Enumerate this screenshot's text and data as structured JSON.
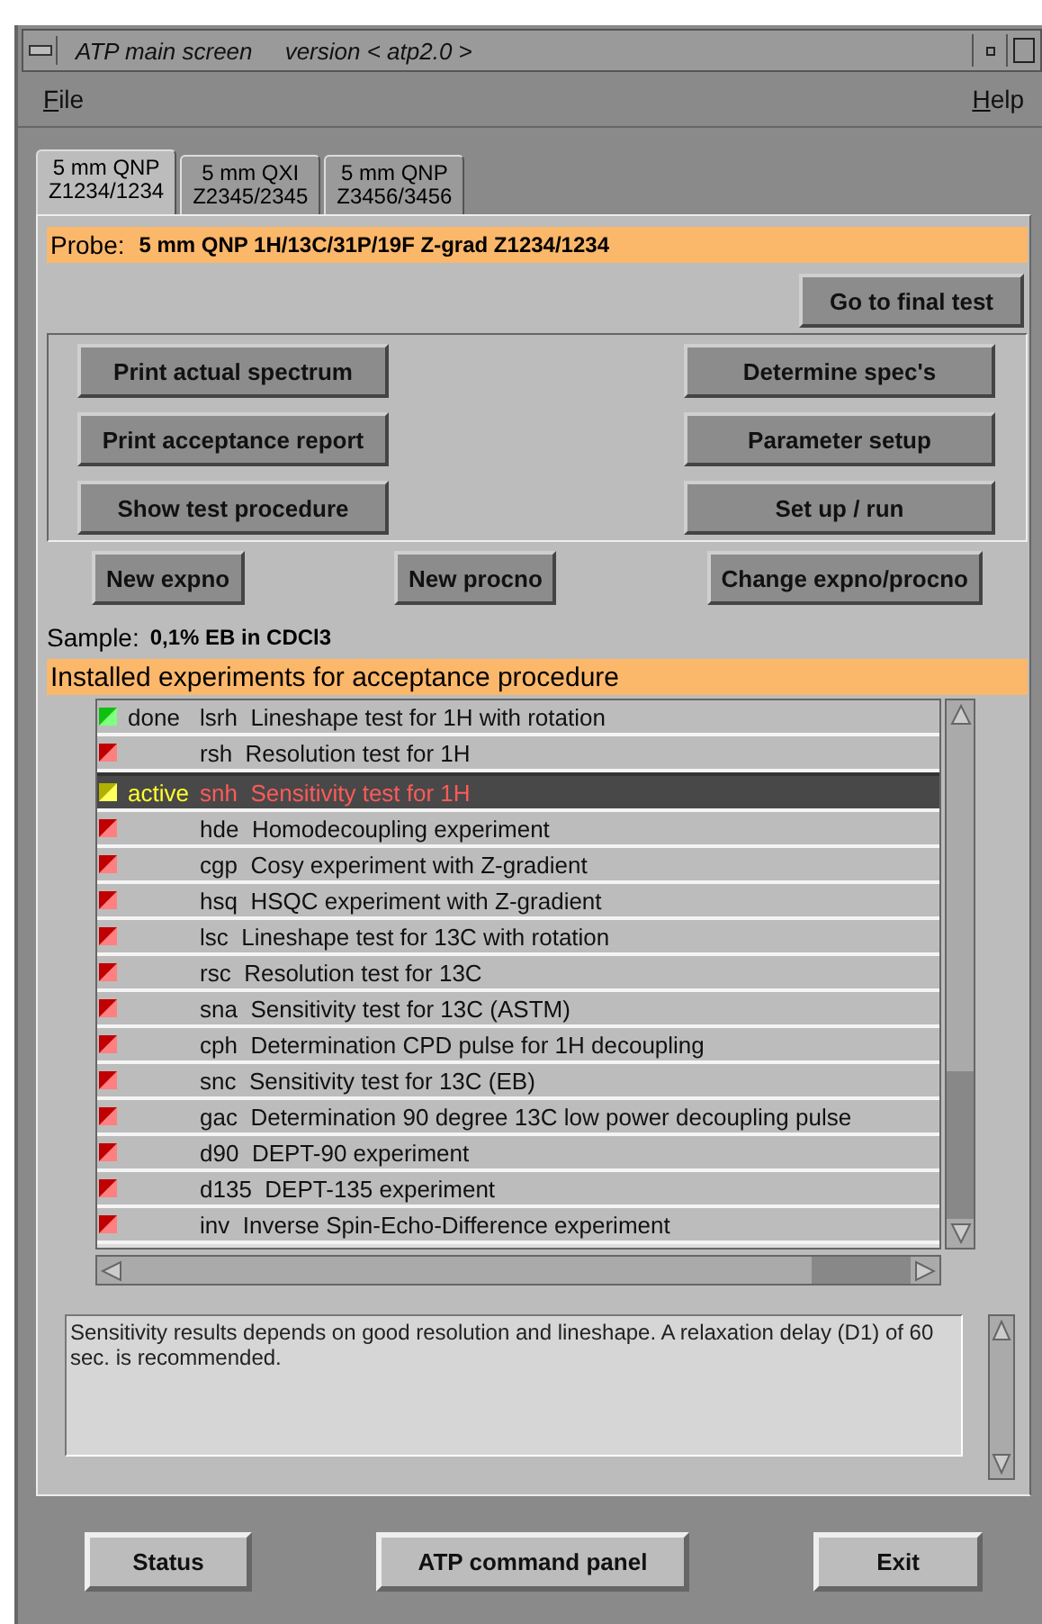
{
  "window": {
    "title": "ATP main screen     version < atp2.0 >"
  },
  "menu": [
    {
      "label": "File",
      "underline_first": true
    },
    {
      "label": "Help",
      "underline_first": true
    }
  ],
  "tabs": [
    {
      "line1": "5 mm QNP",
      "line2": "Z1234/1234",
      "selected": true
    },
    {
      "line1": "5 mm QXI",
      "line2": "Z2345/2345",
      "selected": false
    },
    {
      "line1": "5 mm QNP",
      "line2": "Z3456/3456",
      "selected": false
    }
  ],
  "probe": {
    "label": "Probe:",
    "value": "5 mm QNP  1H/13C/31P/19F Z-grad Z1234/1234"
  },
  "final_test_button": "Go to final test",
  "left_buttons": [
    "Print actual spectrum",
    "Print acceptance report",
    "Show test procedure"
  ],
  "right_buttons": [
    "Determine spec's",
    "Parameter setup",
    "Set up / run"
  ],
  "expno_buttons": [
    "New expno",
    "New procno",
    "Change expno/procno"
  ],
  "sample": {
    "label": "Sample:",
    "value": "0,1% EB in CDCl3"
  },
  "experiments_header": "Installed experiments for acceptance procedure",
  "experiments": [
    {
      "kind": "done",
      "state": "done",
      "code": "lsrh",
      "description": "Lineshape test for 1H with rotation",
      "selected": false
    },
    {
      "kind": "pending",
      "code": "rsh",
      "description": "Resolution test for 1H",
      "selected": false
    },
    {
      "kind": "active",
      "state": "active",
      "code": "snh",
      "description": "Sensitivity test for 1H",
      "selected": true
    },
    {
      "kind": "pending",
      "code": "hde",
      "description": "Homodecoupling experiment",
      "selected": false
    },
    {
      "kind": "pending",
      "code": "cgp",
      "description": "Cosy experiment with Z-gradient",
      "selected": false
    },
    {
      "kind": "pending",
      "code": "hsq",
      "description": "HSQC experiment with Z-gradient",
      "selected": false
    },
    {
      "kind": "pending",
      "code": "lsc",
      "description": "Lineshape test for 13C with rotation",
      "selected": false
    },
    {
      "kind": "pending",
      "code": "rsc",
      "description": "Resolution test for 13C",
      "selected": false
    },
    {
      "kind": "pending",
      "code": "sna",
      "description": "Sensitivity test for 13C (ASTM)",
      "selected": false
    },
    {
      "kind": "pending",
      "code": "cph",
      "description": "Determination CPD pulse for 1H decoupling",
      "selected": false
    },
    {
      "kind": "pending",
      "code": "snc",
      "description": "Sensitivity test for 13C (EB)",
      "selected": false
    },
    {
      "kind": "pending",
      "code": "gac",
      "description": "Determination 90 degree 13C low power decoupling pulse",
      "selected": false
    },
    {
      "kind": "pending",
      "code": "d90",
      "description": "DEPT-90 experiment",
      "selected": false
    },
    {
      "kind": "pending",
      "code": "d135",
      "description": "DEPT-135 experiment",
      "selected": false
    },
    {
      "kind": "pending",
      "code": "inv",
      "description": "Inverse Spin-Echo-Difference experiment",
      "selected": false
    }
  ],
  "info_text": "Sensitivity results depends on good resolution and lineshape. A relaxation delay (D1) of 60 sec. is recommended.",
  "bottom_buttons": [
    "Status",
    "ATP command panel",
    "Exit"
  ]
}
